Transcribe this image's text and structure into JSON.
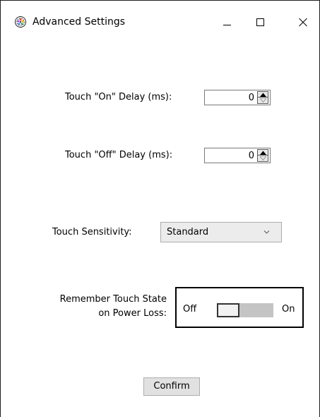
{
  "window": {
    "title": "Advanced Settings",
    "app_icon": "gear-flower-icon",
    "caption_buttons": {
      "minimize_icon": "minimize-icon",
      "maximize_icon": "maximize-icon",
      "close_icon": "close-icon"
    }
  },
  "settings": {
    "touch_on_delay": {
      "label": "Touch \"On\" Delay (ms):",
      "value": "0"
    },
    "touch_off_delay": {
      "label": "Touch \"Off\" Delay (ms):",
      "value": "0"
    },
    "touch_sensitivity": {
      "label": "Touch Sensitivity:",
      "selected": "Standard"
    },
    "remember_touch_state": {
      "label_line1": "Remember Touch State",
      "label_line2": "on Power Loss:",
      "off_label": "Off",
      "on_label": "On",
      "state": "Off"
    }
  },
  "actions": {
    "confirm_label": "Confirm"
  },
  "colors": {
    "toggle_track": "#c4c4c4",
    "button_face": "#e1e1e1",
    "dropdown_face": "#ececec"
  }
}
